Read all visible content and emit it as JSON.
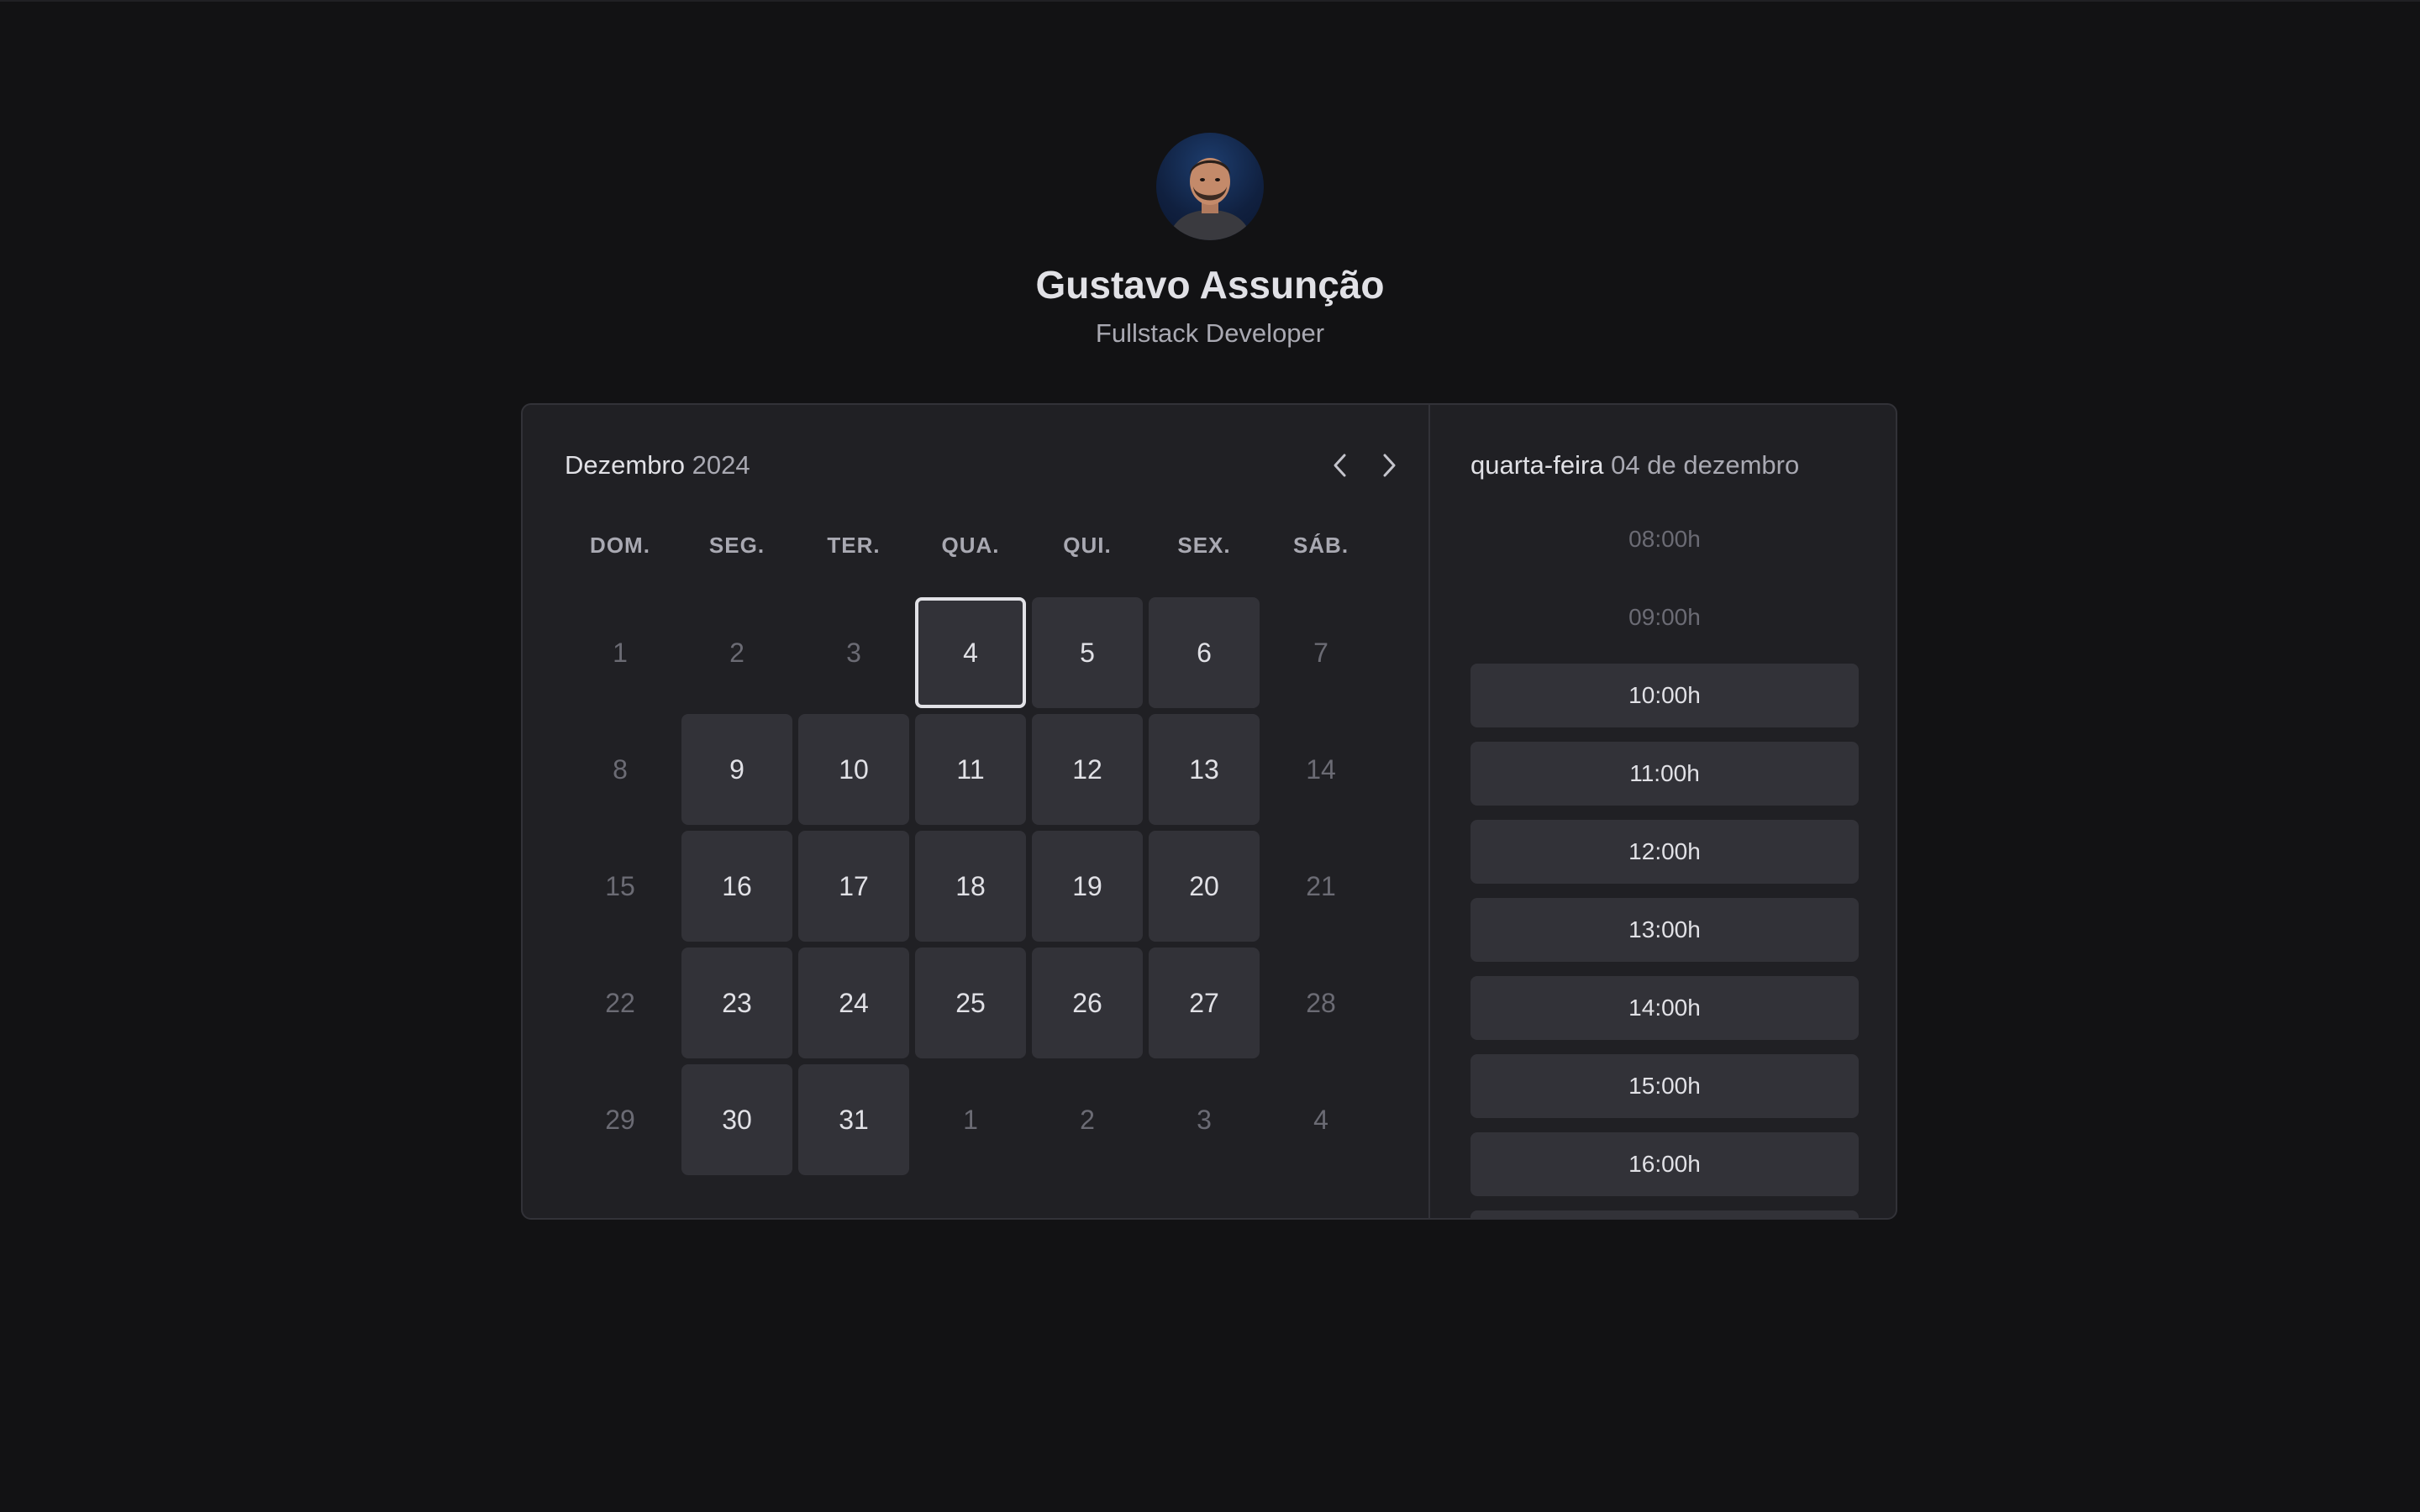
{
  "profile": {
    "name": "Gustavo Assunção",
    "role": "Fullstack Developer"
  },
  "calendar": {
    "month": "Dezembro",
    "year": "2024",
    "weekdays": [
      "DOM.",
      "SEG.",
      "TER.",
      "QUA.",
      "QUI.",
      "SEX.",
      "SÁB."
    ],
    "weeks": [
      [
        {
          "d": "1",
          "s": "off"
        },
        {
          "d": "2",
          "s": "off"
        },
        {
          "d": "3",
          "s": "off"
        },
        {
          "d": "4",
          "s": "selected"
        },
        {
          "d": "5",
          "s": "avail"
        },
        {
          "d": "6",
          "s": "avail"
        },
        {
          "d": "7",
          "s": "off"
        }
      ],
      [
        {
          "d": "8",
          "s": "off"
        },
        {
          "d": "9",
          "s": "avail"
        },
        {
          "d": "10",
          "s": "avail"
        },
        {
          "d": "11",
          "s": "avail"
        },
        {
          "d": "12",
          "s": "avail"
        },
        {
          "d": "13",
          "s": "avail"
        },
        {
          "d": "14",
          "s": "off"
        }
      ],
      [
        {
          "d": "15",
          "s": "off"
        },
        {
          "d": "16",
          "s": "avail"
        },
        {
          "d": "17",
          "s": "avail"
        },
        {
          "d": "18",
          "s": "avail"
        },
        {
          "d": "19",
          "s": "avail"
        },
        {
          "d": "20",
          "s": "avail"
        },
        {
          "d": "21",
          "s": "off"
        }
      ],
      [
        {
          "d": "22",
          "s": "off"
        },
        {
          "d": "23",
          "s": "avail"
        },
        {
          "d": "24",
          "s": "avail"
        },
        {
          "d": "25",
          "s": "avail"
        },
        {
          "d": "26",
          "s": "avail"
        },
        {
          "d": "27",
          "s": "avail"
        },
        {
          "d": "28",
          "s": "off"
        }
      ],
      [
        {
          "d": "29",
          "s": "off"
        },
        {
          "d": "30",
          "s": "avail"
        },
        {
          "d": "31",
          "s": "avail"
        },
        {
          "d": "1",
          "s": "off"
        },
        {
          "d": "2",
          "s": "off"
        },
        {
          "d": "3",
          "s": "off"
        },
        {
          "d": "4",
          "s": "off"
        }
      ]
    ],
    "icons": {
      "prev": "chevron-left-icon",
      "next": "chevron-right-icon"
    }
  },
  "time_picker": {
    "weekday": "quarta-feira",
    "date": "04 de dezembro",
    "slots": [
      {
        "label": "08:00h",
        "enabled": false
      },
      {
        "label": "09:00h",
        "enabled": false
      },
      {
        "label": "10:00h",
        "enabled": true
      },
      {
        "label": "11:00h",
        "enabled": true
      },
      {
        "label": "12:00h",
        "enabled": true
      },
      {
        "label": "13:00h",
        "enabled": true
      },
      {
        "label": "14:00h",
        "enabled": true
      },
      {
        "label": "15:00h",
        "enabled": true
      },
      {
        "label": "16:00h",
        "enabled": true
      },
      {
        "label": "",
        "enabled": true
      }
    ]
  },
  "colors": {
    "background": "#121214",
    "card": "#202024",
    "cell": "#323238",
    "text": "#e1e1e6",
    "muted": "#a9a9b2"
  }
}
